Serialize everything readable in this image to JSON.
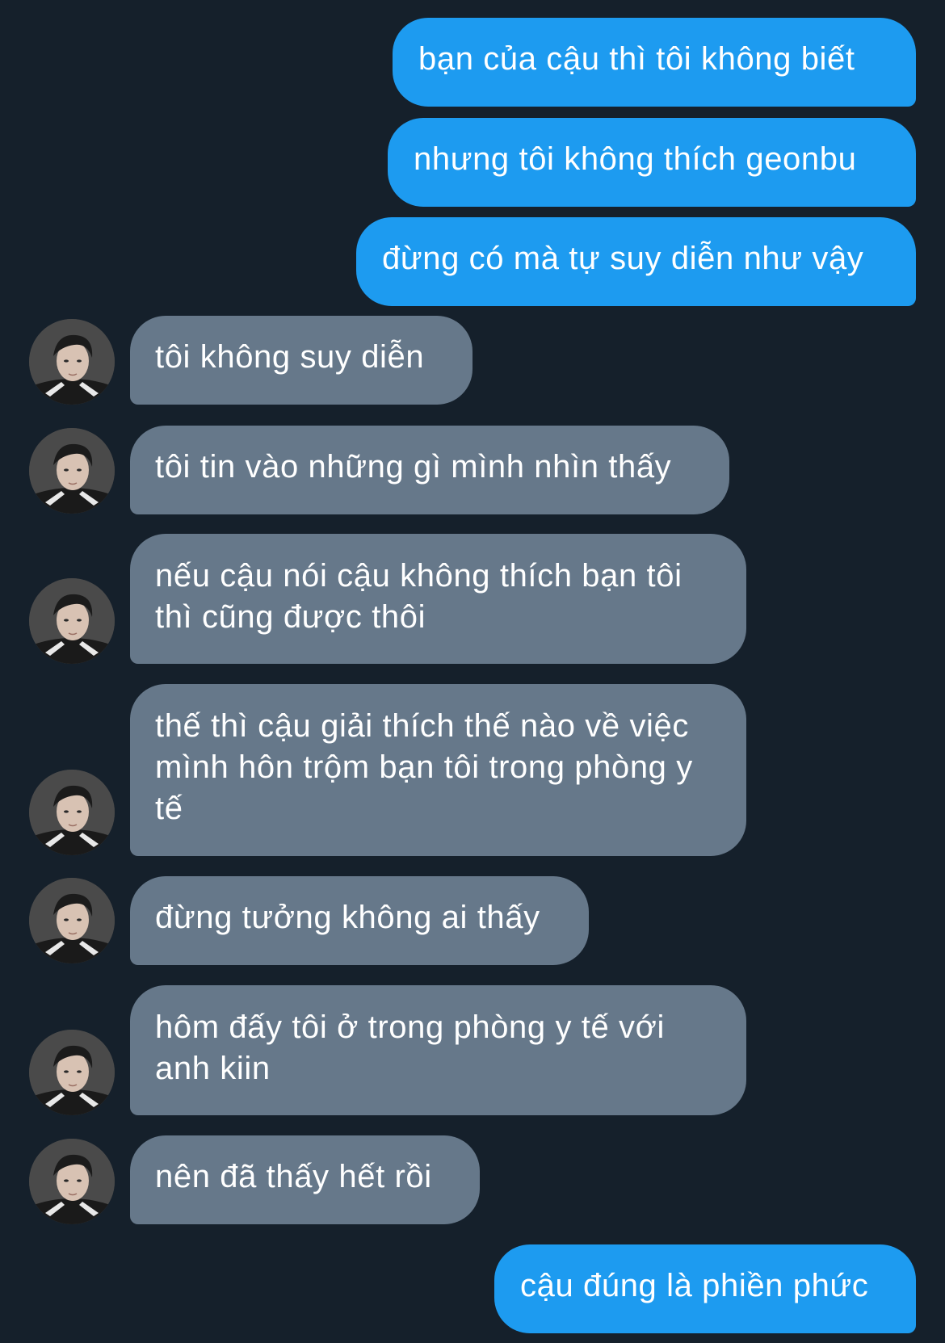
{
  "conversation": {
    "messages": [
      {
        "side": "sent",
        "text": "bạn của cậu thì tôi không biết"
      },
      {
        "side": "sent",
        "text": "nhưng tôi không thích geonbu"
      },
      {
        "side": "sent",
        "text": "đừng có mà tự suy diễn như vậy"
      },
      {
        "side": "received",
        "text": "tôi không suy diễn"
      },
      {
        "side": "received",
        "text": "tôi tin vào những gì mình nhìn thấy"
      },
      {
        "side": "received",
        "text": "nếu cậu nói cậu không thích bạn tôi thì cũng được thôi"
      },
      {
        "side": "received",
        "text": "thế thì cậu giải thích thế nào về việc mình hôn trộm bạn tôi trong phòng y tế"
      },
      {
        "side": "received",
        "text": "đừng tưởng không ai thấy"
      },
      {
        "side": "received",
        "text": "hôm đấy tôi ở trong phòng y tế với anh kiin"
      },
      {
        "side": "received",
        "text": "nên đã thấy hết rồi"
      },
      {
        "side": "sent",
        "text": "cậu đúng là phiền phức"
      }
    ]
  },
  "colors": {
    "background": "#15202b",
    "sent_bubble": "#1d9bf0",
    "received_bubble": "#66788a",
    "text": "#ffffff"
  },
  "icons": {
    "avatar": "profile-photo-avatar"
  }
}
